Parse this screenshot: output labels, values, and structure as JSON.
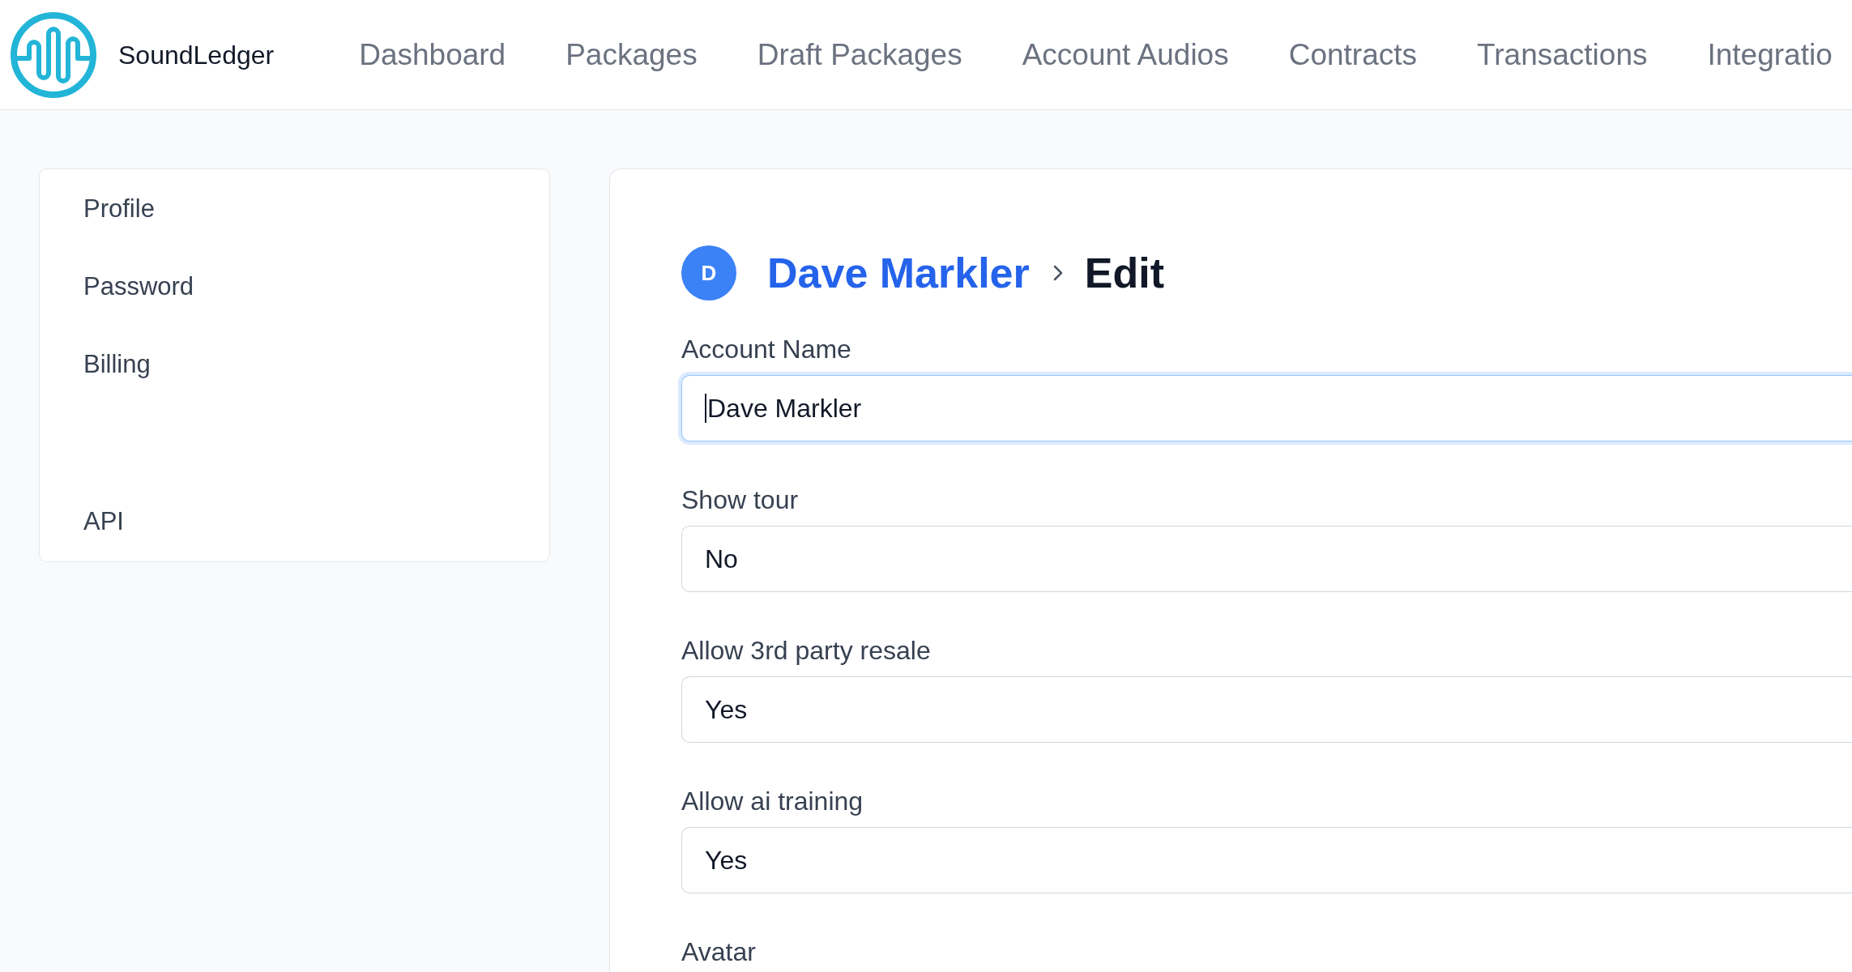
{
  "header": {
    "brand": "SoundLedger",
    "nav": [
      "Dashboard",
      "Packages",
      "Draft Packages",
      "Account Audios",
      "Contracts",
      "Transactions",
      "Integratio"
    ]
  },
  "sidebar": {
    "groups": [
      [
        "Profile",
        "Password",
        "Billing"
      ],
      [
        "API"
      ]
    ]
  },
  "page": {
    "avatar_initial": "D",
    "breadcrumb": {
      "parent": "Dave Markler",
      "current": "Edit"
    },
    "fields": [
      {
        "label": "Account Name",
        "value": "Dave Markler",
        "focused": true
      },
      {
        "label": "Show tour",
        "value": "No",
        "focused": false
      },
      {
        "label": "Allow 3rd party resale",
        "value": "Yes",
        "focused": false
      },
      {
        "label": "Allow ai training",
        "value": "Yes",
        "focused": false
      },
      {
        "label": "Avatar"
      }
    ]
  }
}
